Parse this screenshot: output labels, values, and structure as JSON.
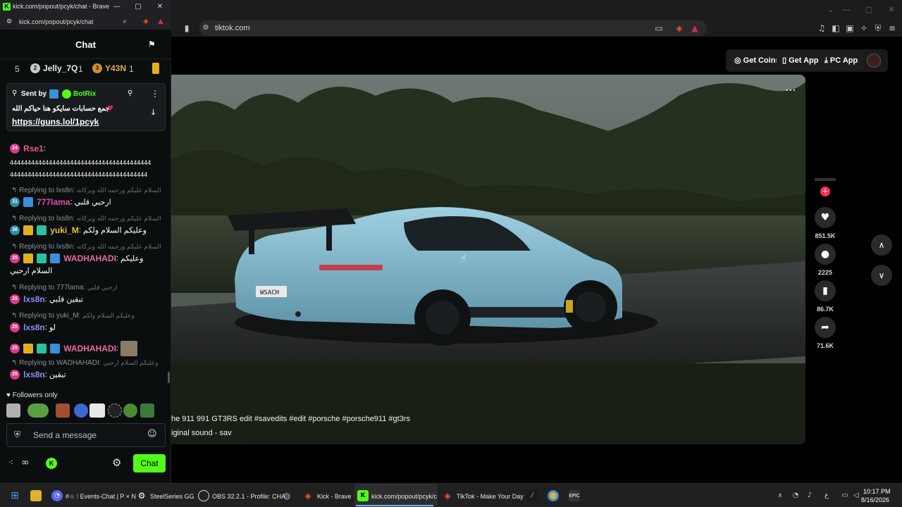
{
  "kick": {
    "window_title": "kick.com/popout/pcyk/chat - Brave",
    "url": "kick.com/popout/pcyk/chat",
    "chat_title": "Chat",
    "leaderboard": [
      {
        "rank_label": "5",
        "badge": "",
        "name": "",
        "count": ""
      },
      {
        "rank_label": "",
        "badge": "2",
        "name": "Jelly_7Q",
        "count": "1"
      },
      {
        "rank_label": "",
        "badge": "3",
        "name": "Y43N",
        "count": "1"
      }
    ],
    "pinned": {
      "sent_by_label": "Sent by",
      "sender": "BotRix",
      "message": "جمع حسابات سايكو هنا حياكم الله",
      "link": "https://guns.lol/1pcyk"
    },
    "messages": [
      {
        "badge": "24",
        "user": "Rse1",
        "text": "4444444444444444444444444444444444444444\n444444444444444444444444444444444444444"
      },
      {
        "reply_to": "Replying to lxs8n:",
        "reply_quote": "السلام عليكم ورحمه الله وبركاته",
        "badge": "31",
        "user": "777lama",
        "text": "ارحبي قلبي"
      },
      {
        "reply_to": "Replying to lxs8n:",
        "reply_quote": "السلام عليكم ورحمه الله وبركاته",
        "badge": "38",
        "user": "yuki_M",
        "text": "وعليكم السلام ولكم"
      },
      {
        "reply_to": "Replying to lxs8n:",
        "reply_quote": "السلام عليكم ورحمه الله وبركاته",
        "badge": "25",
        "user": "WADHAHADI",
        "text": "وعليكم",
        "text2": "السلام ارحبي"
      },
      {
        "reply_to": "Replying to 777lama:",
        "reply_quote": "ارحبي قلبي",
        "badge": "25",
        "user": "lxs8n",
        "text": "تبقين قلبي"
      },
      {
        "reply_to": "Replying to yuki_M:",
        "reply_quote": "وعليكم السلام ولكم",
        "badge": "25",
        "user": "lxs8n",
        "text": "لو"
      },
      {
        "badge": "25",
        "user": "WADHAHADI",
        "text": ""
      },
      {
        "reply_to": "Replying to WADHAHADI:",
        "reply_quote": "وعليكم السلام ارحبي",
        "badge": "25",
        "user": "lxs8n",
        "text": "تبقين"
      }
    ],
    "followers_only": "Followers only",
    "input_placeholder": "Send a message",
    "chat_button": "Chat"
  },
  "tiktok": {
    "url": "tiktok.com",
    "top_buttons": [
      "Get Coins",
      "Get App",
      "PC App"
    ],
    "caption": "he 911 991 GT3RS edit #savedits #edit #porsche #porsche911 #gt3rs",
    "sound": "iginal sound - sav",
    "likes": "851.5K",
    "comments": "2225",
    "saves": "86.7K",
    "shares": "71.6K",
    "plate": "WSACH"
  },
  "taskbar": {
    "items": [
      "#☆ ⁞ Events-Chat | P × N",
      "SteelSeries GG",
      "OBS 32.2.1 - Profile: CHA",
      "Kick - Brave",
      "kick.com/popout/pcyk/c",
      "TikTok - Make Your Day"
    ],
    "time": "10:17 PM",
    "date": "8/16/2026"
  },
  "colors": {
    "kick_green": "#53fc18",
    "tiktok_red": "#fe2c55",
    "porsche_blue": "#8fc3d6"
  }
}
